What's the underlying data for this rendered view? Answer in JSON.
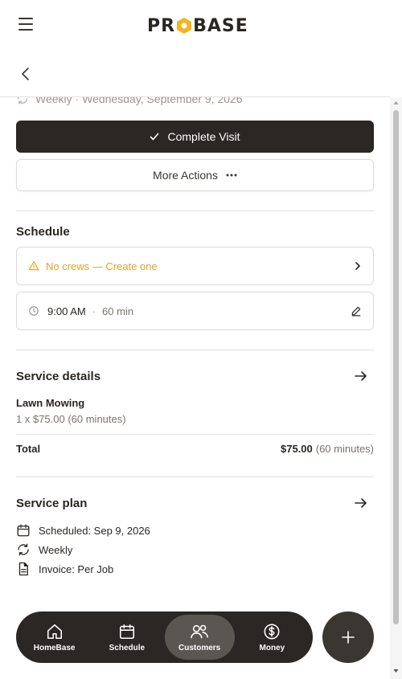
{
  "header": {
    "logo_text": "PROBASE",
    "logo_left": "PR",
    "logo_right": "BASE"
  },
  "visit": {
    "recurrence_text": "Weekly · Wednesday, September 9, 2026",
    "complete_label": "Complete Visit",
    "more_actions_label": "More Actions"
  },
  "schedule": {
    "title": "Schedule",
    "crew_warning": "No crews — Create one",
    "time": "9:00 AM",
    "separator": "·",
    "duration": "60 min"
  },
  "service_details": {
    "title": "Service details",
    "item_name": "Lawn Mowing",
    "item_detail": "1 x $75.00 (60 minutes)",
    "total_label": "Total",
    "total_amount": "$75.00",
    "total_duration": "(60 minutes)"
  },
  "service_plan": {
    "title": "Service plan",
    "scheduled": "Scheduled: Sep 9, 2026",
    "frequency": "Weekly",
    "invoice": "Invoice: Per Job"
  },
  "bottom_nav": {
    "items": [
      {
        "label": "HomeBase",
        "icon": "home-icon",
        "active": false
      },
      {
        "label": "Schedule",
        "icon": "calendar-icon",
        "active": false
      },
      {
        "label": "Customers",
        "icon": "users-icon",
        "active": true
      },
      {
        "label": "Money",
        "icon": "dollar-icon",
        "active": false
      }
    ],
    "fab_icon": "plus-icon"
  },
  "colors": {
    "primary_dark": "#2b2724",
    "warning": "#e2a12a",
    "logo_accent": "#f2b51d",
    "muted_text": "#7a746d"
  }
}
